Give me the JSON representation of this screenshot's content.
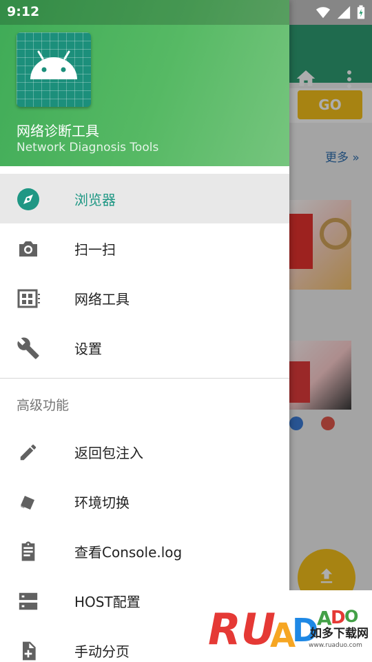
{
  "status_bar": {
    "time": "9:12"
  },
  "background": {
    "go_button": "GO",
    "more_link": "更多 »",
    "colors": {
      "toolbar": "#2e9e73",
      "accent": "#f6c21b"
    }
  },
  "drawer": {
    "header": {
      "app_name": "网络诊断工具",
      "app_name_en": "Network Diagnosis Tools"
    },
    "items": [
      {
        "label": "浏览器",
        "icon": "compass-icon",
        "active": true
      },
      {
        "label": "扫一扫",
        "icon": "camera-icon"
      },
      {
        "label": "网络工具",
        "icon": "dashboard-icon"
      },
      {
        "label": "设置",
        "icon": "wrench-icon"
      }
    ],
    "section_title": "高级功能",
    "advanced_items": [
      {
        "label": "返回包注入",
        "icon": "pencil-icon"
      },
      {
        "label": "环境切换",
        "icon": "swatches-icon"
      },
      {
        "label": "查看Console.log",
        "icon": "clipboard-icon"
      },
      {
        "label": "HOST配置",
        "icon": "storage-icon"
      },
      {
        "label": "手动分页",
        "icon": "file-add-icon"
      }
    ]
  },
  "watermark": {
    "text": "RUANDAO",
    "subtitle": "如多下载网",
    "url": "www.ruaduo.com"
  },
  "colors": {
    "header_green": "#4fb45f",
    "active_text": "#1f9784",
    "icon_gray": "#616161"
  }
}
